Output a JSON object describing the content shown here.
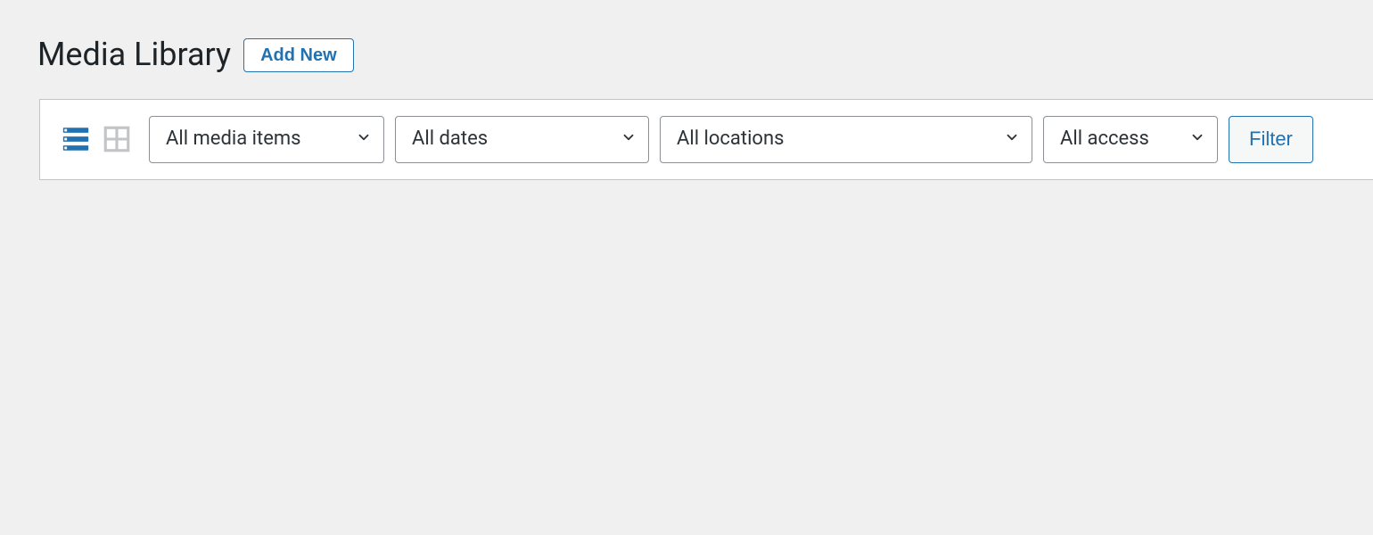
{
  "header": {
    "title": "Media Library",
    "add_new_label": "Add New"
  },
  "toolbar": {
    "view_list_icon": "list-view",
    "view_grid_icon": "grid-view",
    "filters": {
      "media_items": "All media items",
      "dates": "All dates",
      "locations": "All locations",
      "access": "All access"
    },
    "filter_button_label": "Filter"
  }
}
